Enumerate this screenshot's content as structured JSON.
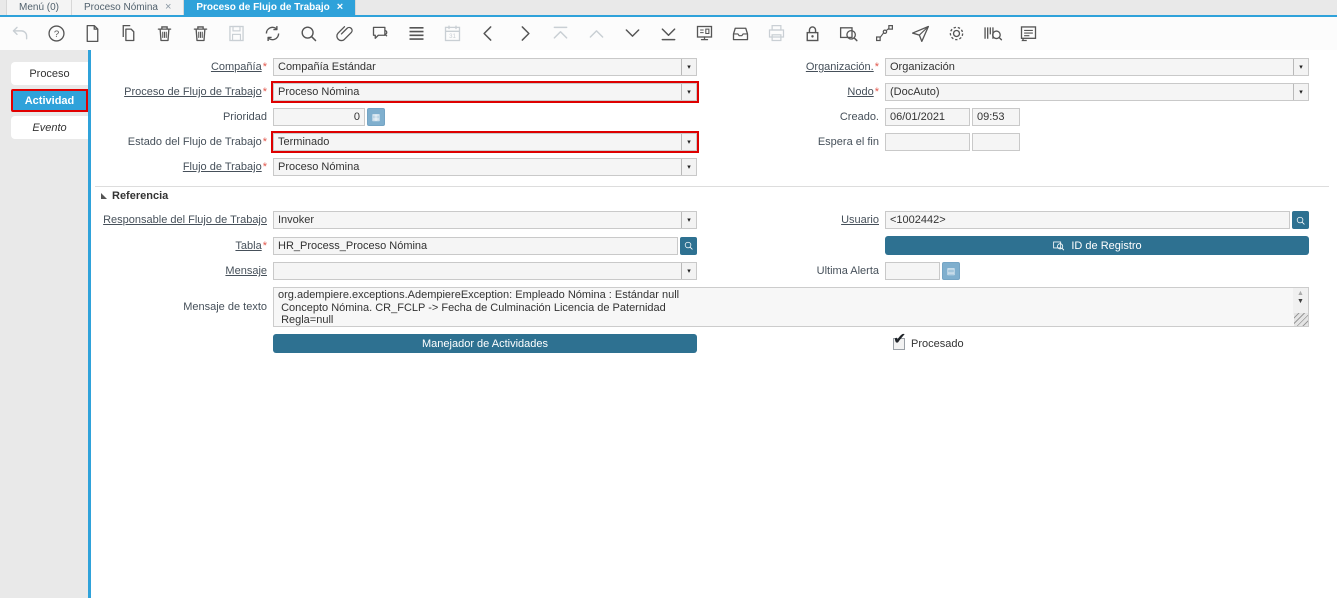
{
  "window": {
    "tabs": [
      {
        "label": "Menú (0)",
        "active": false,
        "closable": false
      },
      {
        "label": "Proceso Nómina",
        "active": false,
        "closable": true
      },
      {
        "label": "Proceso de Flujo de Trabajo",
        "active": true,
        "closable": true
      }
    ],
    "close_glyph": "×"
  },
  "toolbar": {
    "icons": [
      {
        "name": "undo",
        "sym": "undo",
        "disabled": true
      },
      {
        "name": "help",
        "sym": "help",
        "disabled": false
      },
      {
        "name": "new-record",
        "sym": "new",
        "disabled": false
      },
      {
        "name": "copy-record",
        "sym": "copy",
        "disabled": false
      },
      {
        "name": "delete-record",
        "sym": "trash",
        "disabled": false
      },
      {
        "name": "delete-selection",
        "sym": "trash",
        "disabled": false
      },
      {
        "name": "save",
        "sym": "save",
        "disabled": true
      },
      {
        "name": "refresh",
        "sym": "refresh",
        "disabled": false
      },
      {
        "name": "find",
        "sym": "find",
        "disabled": false
      },
      {
        "name": "attachment",
        "sym": "clip",
        "disabled": false
      },
      {
        "name": "chat",
        "sym": "chat",
        "disabled": false
      },
      {
        "name": "toggle-grid",
        "sym": "lines",
        "disabled": false
      },
      {
        "name": "calendar",
        "sym": "cal",
        "disabled": true
      },
      {
        "name": "parent-record",
        "sym": "chevl",
        "disabled": false
      },
      {
        "name": "detail-record",
        "sym": "chevr",
        "disabled": false
      },
      {
        "name": "first-record",
        "sym": "first",
        "disabled": true
      },
      {
        "name": "previous-record",
        "sym": "up",
        "disabled": true
      },
      {
        "name": "next-record",
        "sym": "down",
        "disabled": false
      },
      {
        "name": "last-record",
        "sym": "last",
        "disabled": false
      },
      {
        "name": "report",
        "sym": "report",
        "disabled": false
      },
      {
        "name": "archive",
        "sym": "archive",
        "disabled": false
      },
      {
        "name": "print",
        "sym": "print",
        "disabled": true
      },
      {
        "name": "lock",
        "sym": "lock",
        "disabled": false
      },
      {
        "name": "zoom-across",
        "sym": "zoomx",
        "disabled": false
      },
      {
        "name": "workflow",
        "sym": "wf",
        "disabled": false
      },
      {
        "name": "send-request",
        "sym": "plane",
        "disabled": false
      },
      {
        "name": "preference",
        "sym": "gear",
        "disabled": false
      },
      {
        "name": "product-info",
        "sym": "barcode",
        "disabled": false
      },
      {
        "name": "memo",
        "sym": "memo",
        "disabled": false
      }
    ]
  },
  "side_tabs": [
    {
      "label": "Proceso",
      "selected": false
    },
    {
      "label": "Actividad",
      "selected": true
    },
    {
      "label": "Evento",
      "selected": false
    }
  ],
  "form": {
    "required_marker": "*",
    "combo_arrow": "▾",
    "calc_glyph": "▦",
    "calendar_glyph": "▤",
    "fields": {
      "compania": {
        "label": "Compañía",
        "value": "Compañía Estándar"
      },
      "organizacion": {
        "label": "Organización.",
        "value": "Organización"
      },
      "proceso_flujo": {
        "label": "Proceso de Flujo de Trabajo",
        "value": "Proceso Nómina"
      },
      "nodo": {
        "label": "Nodo",
        "value": "(DocAuto)"
      },
      "prioridad": {
        "label": "Prioridad",
        "value": "0"
      },
      "creado": {
        "label": "Creado.",
        "date": "06/01/2021",
        "time": "09:53"
      },
      "estado": {
        "label": "Estado del Flujo de Trabajo",
        "value": "Terminado"
      },
      "espera_fin": {
        "label": "Espera el fin",
        "date": "",
        "time": ""
      },
      "flujo": {
        "label": "Flujo de Trabajo",
        "value": "Proceso Nómina"
      },
      "responsable": {
        "label": "Responsable del Flujo de Trabajo",
        "value": "Invoker"
      },
      "usuario": {
        "label": "Usuario",
        "value": "<1002442>"
      },
      "tabla": {
        "label": "Tabla",
        "value": "HR_Process_Proceso Nómina"
      },
      "mensaje": {
        "label": "Mensaje",
        "value": ""
      },
      "ultima_alerta": {
        "label": "Ultima Alerta",
        "value": ""
      },
      "mensaje_texto": {
        "label": "Mensaje de texto",
        "value": "org.adempiere.exceptions.AdempiereException: Empleado Nómina : Estándar null\n Concepto Nómina. CR_FCLP -> Fecha de Culminación Licencia de Paternidad\n Regla=null"
      }
    },
    "group_referencia": "Referencia",
    "buttons": {
      "id_registro": "ID de Registro",
      "manejador": "Manejador de Actividades"
    },
    "procesado": {
      "label": "Procesado",
      "checked": true,
      "check_glyph": "✔"
    }
  },
  "colors": {
    "accent_blue": "#2FA2DA",
    "button_blue": "#2E7191",
    "light_button_blue": "#7FAFCE",
    "highlight_red": "#DE0000",
    "field_bg": "#F5F5F5"
  }
}
